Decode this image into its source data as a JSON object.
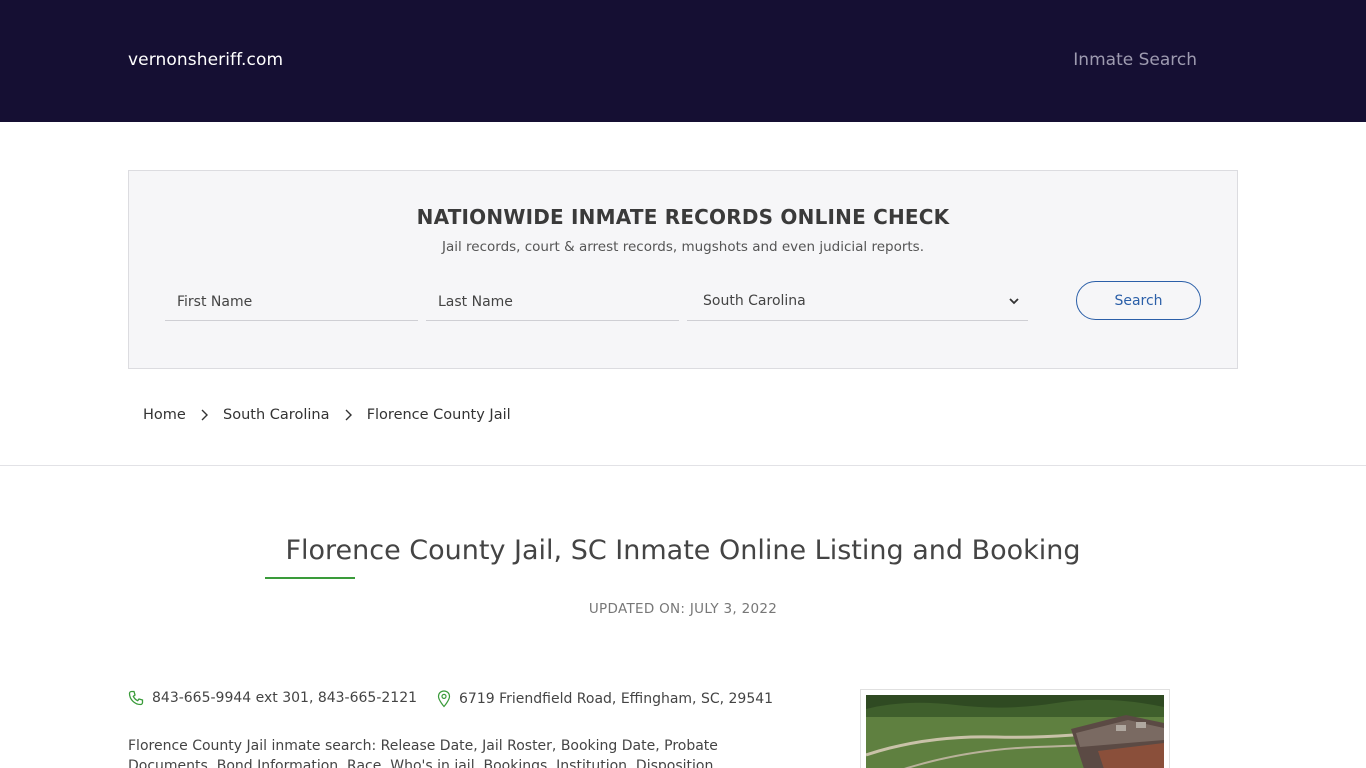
{
  "header": {
    "brand": "vernonsheriff.com",
    "nav_link": "Inmate Search"
  },
  "search_panel": {
    "title": "NATIONWIDE INMATE RECORDS ONLINE CHECK",
    "subtitle": "Jail records, court & arrest records, mugshots and even judicial reports.",
    "first_name_placeholder": "First Name",
    "last_name_placeholder": "Last Name",
    "state_selected": "South Carolina",
    "search_label": "Search"
  },
  "breadcrumb": {
    "items": [
      "Home",
      "South Carolina",
      "Florence County Jail"
    ]
  },
  "main": {
    "title": "Florence County Jail, SC Inmate Online Listing and Booking",
    "updated": "UPDATED ON: JULY 3, 2022",
    "phone": "843-665-9944 ext 301, 843-665-2121",
    "address": "6719 Friendfield Road, Effingham, SC, 29541",
    "description": "Florence County Jail inmate search: Release Date, Jail Roster, Booking Date, Probate Documents, Bond Information, Race, Who's in jail, Bookings, Institution, Disposition"
  },
  "colors": {
    "header_bg": "#150f33",
    "accent_blue": "#2b5fa8",
    "accent_green": "#3a9b3a"
  }
}
